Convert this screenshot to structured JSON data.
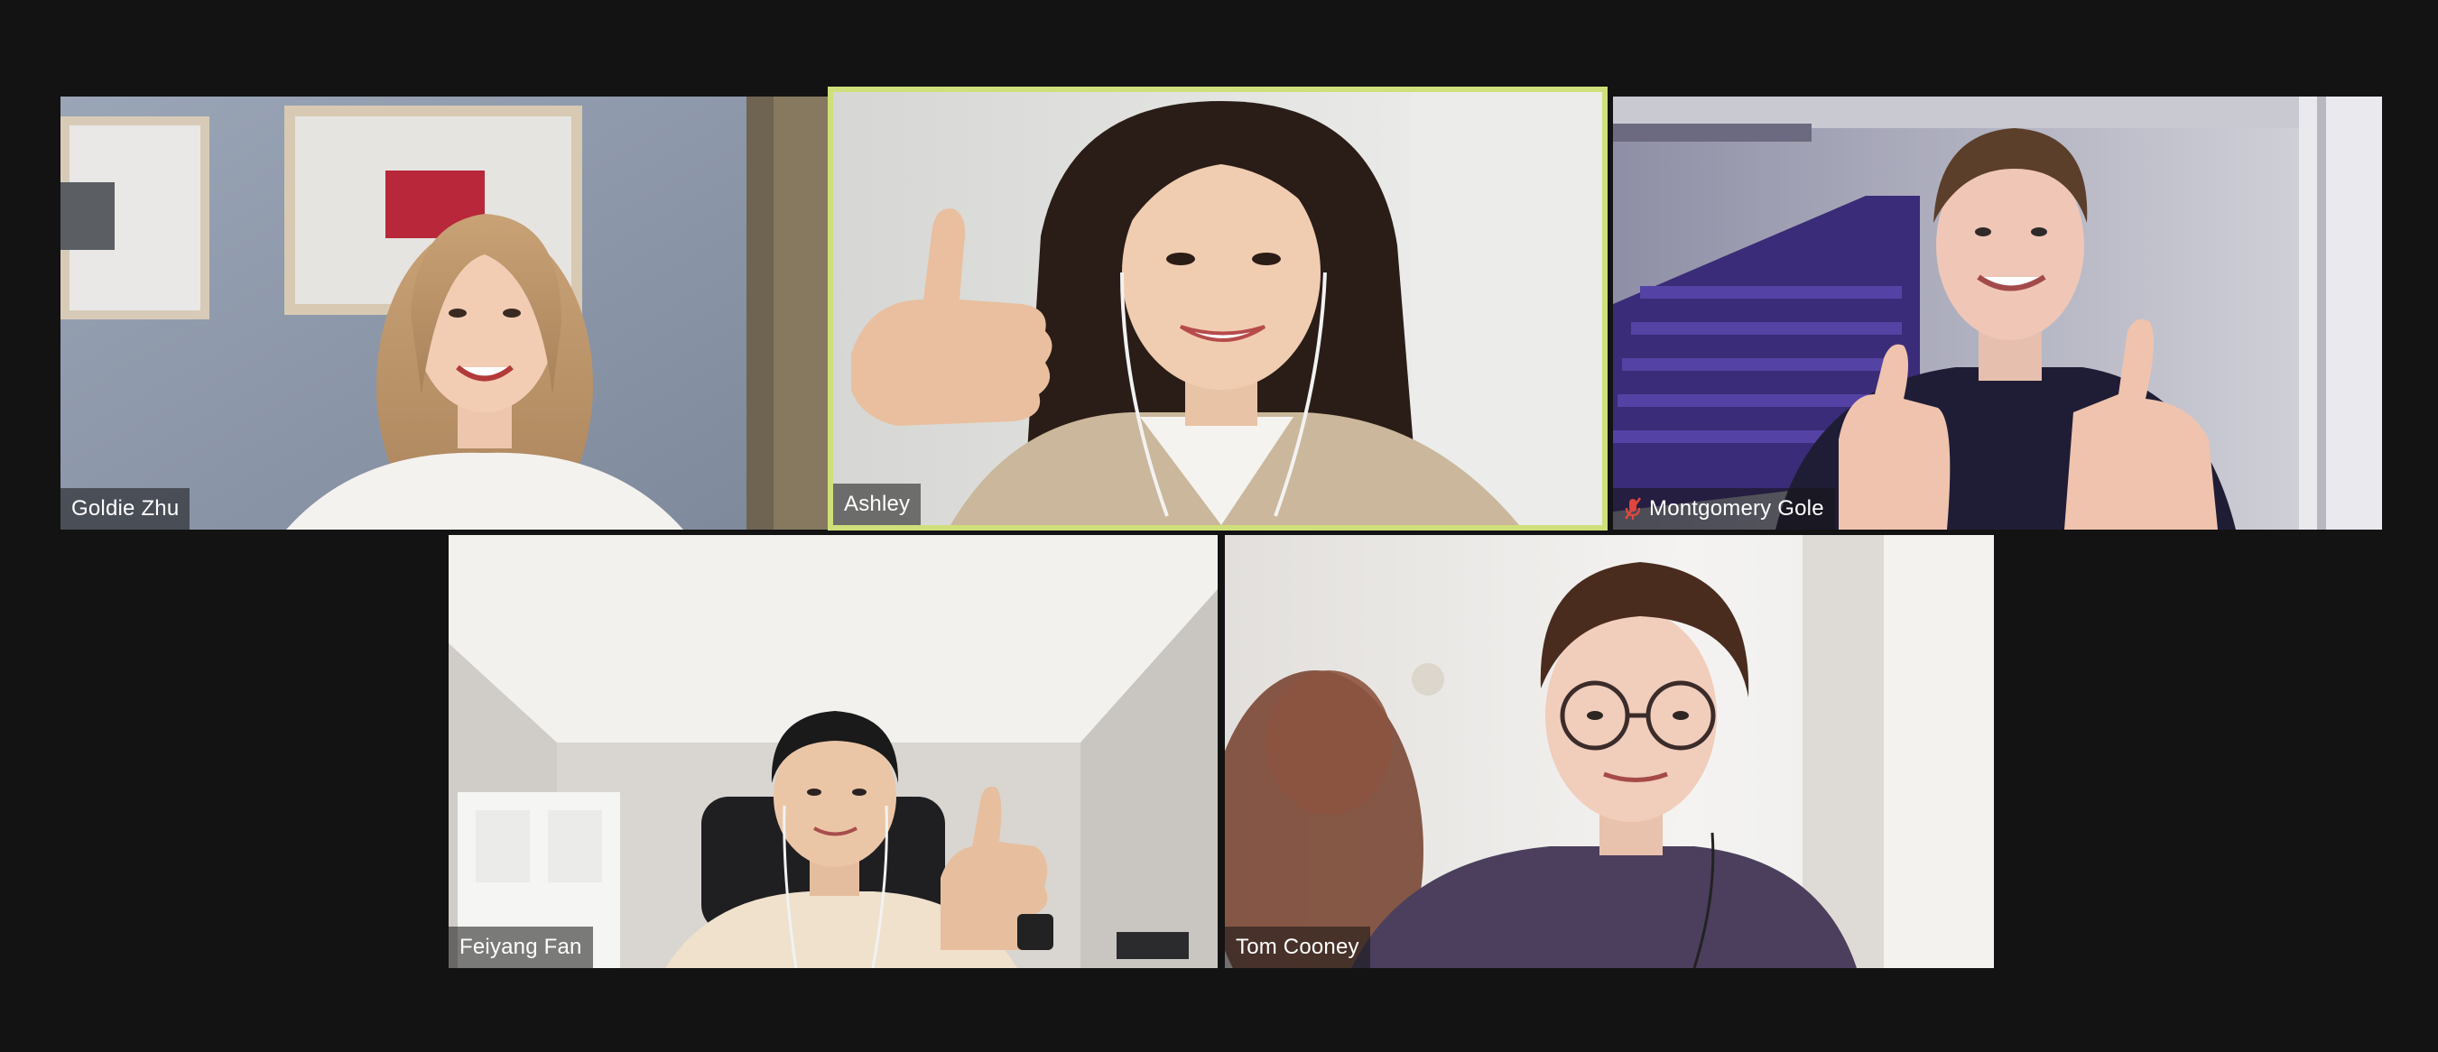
{
  "participants": [
    {
      "name": "Goldie Zhu",
      "muted": false,
      "active_speaker": false
    },
    {
      "name": "Ashley",
      "muted": false,
      "active_speaker": true
    },
    {
      "name": "Montgomery Gole",
      "muted": true,
      "active_speaker": false
    },
    {
      "name": "Feiyang Fan",
      "muted": false,
      "active_speaker": false
    },
    {
      "name": "Tom Cooney",
      "muted": false,
      "active_speaker": false
    }
  ],
  "icons": {
    "muted_mic": "mic-muted-icon"
  },
  "colors": {
    "background": "#131313",
    "active_speaker_border": "#cfe07a",
    "muted_icon": "#e0463c",
    "nameplate_bg": "rgba(20,20,20,0.55)"
  }
}
